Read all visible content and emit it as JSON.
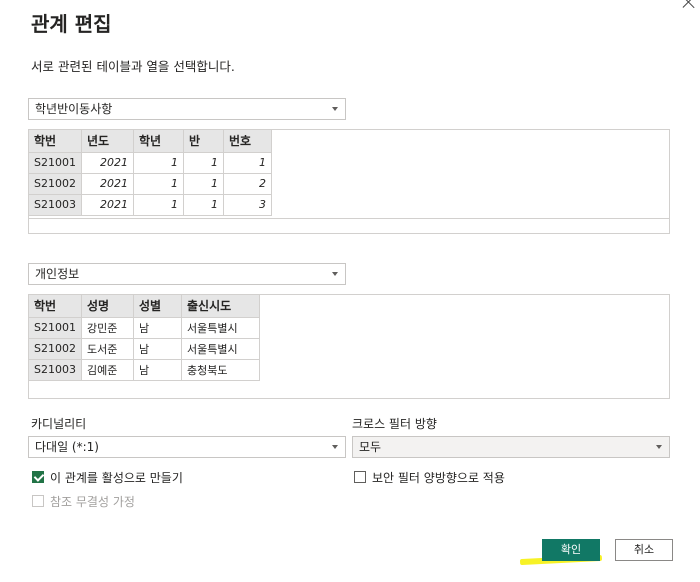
{
  "dialog": {
    "title": "관계 편집",
    "subtitle": "서로 관련된 테이블과 열을 선택합니다."
  },
  "table1": {
    "selected": "학년반이동사항",
    "columns": [
      "학번",
      "년도",
      "학년",
      "반",
      "번호"
    ],
    "rows": [
      [
        "S21001",
        "2021",
        "1",
        "1",
        "1"
      ],
      [
        "S21002",
        "2021",
        "1",
        "1",
        "2"
      ],
      [
        "S21003",
        "2021",
        "1",
        "1",
        "3"
      ]
    ]
  },
  "table2": {
    "selected": "개인정보",
    "columns": [
      "학번",
      "성명",
      "성별",
      "출신시도"
    ],
    "rows": [
      [
        "S21001",
        "강민준",
        "남",
        "서울특별시"
      ],
      [
        "S21002",
        "도서준",
        "남",
        "서울특별시"
      ],
      [
        "S21003",
        "김예준",
        "남",
        "충청북도"
      ]
    ]
  },
  "cardinality": {
    "label": "카디널리티",
    "value": "다대일 (*:1)"
  },
  "cross_filter": {
    "label": "크로스 필터 방향",
    "value": "모두"
  },
  "options": {
    "activate_label": "이 관계를 활성으로 만들기",
    "activate_checked": true,
    "security_filter_label": "보안 필터 양방향으로 적용",
    "security_filter_checked": false,
    "referential_label": "참조 무결성 가정",
    "referential_enabled": false
  },
  "buttons": {
    "ok_label": "확인",
    "cancel_label": "취소"
  },
  "colors": {
    "primary": "#117865",
    "checkbox_checked": "#217346",
    "highlight": "#f6f000"
  }
}
